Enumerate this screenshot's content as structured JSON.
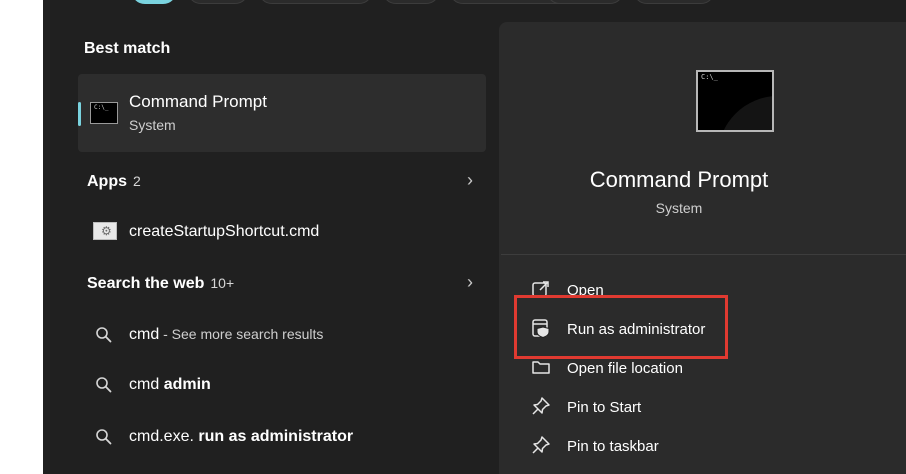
{
  "best_match": {
    "title": "Best match",
    "item_name": "Command Prompt",
    "item_sub": "System",
    "icon": "cmd-window-icon"
  },
  "apps": {
    "title": "Apps",
    "count": "2",
    "items": [
      {
        "label": "createStartupShortcut.cmd",
        "icon": "cmd-file-icon"
      }
    ]
  },
  "web": {
    "title": "Search the web",
    "count": "10+",
    "items": [
      {
        "query": "cmd",
        "suffix": " - See more search results"
      },
      {
        "query": "cmd",
        "bold": "admin"
      },
      {
        "query": "cmd.exe. ",
        "bold": "run as administrator"
      }
    ]
  },
  "detail": {
    "title": "Command Prompt",
    "subtitle": "System",
    "actions": [
      {
        "label": "Open",
        "icon": "open-icon"
      },
      {
        "label": "Run as administrator",
        "icon": "shield-admin-icon"
      },
      {
        "label": "Open file location",
        "icon": "folder-icon"
      },
      {
        "label": "Pin to Start",
        "icon": "pin-icon"
      },
      {
        "label": "Pin to taskbar",
        "icon": "pin-icon"
      }
    ]
  },
  "colors": {
    "accent": "#7ad3df",
    "highlight": "#e03a31",
    "background": "#202020",
    "pane": "#2b2b2b"
  }
}
